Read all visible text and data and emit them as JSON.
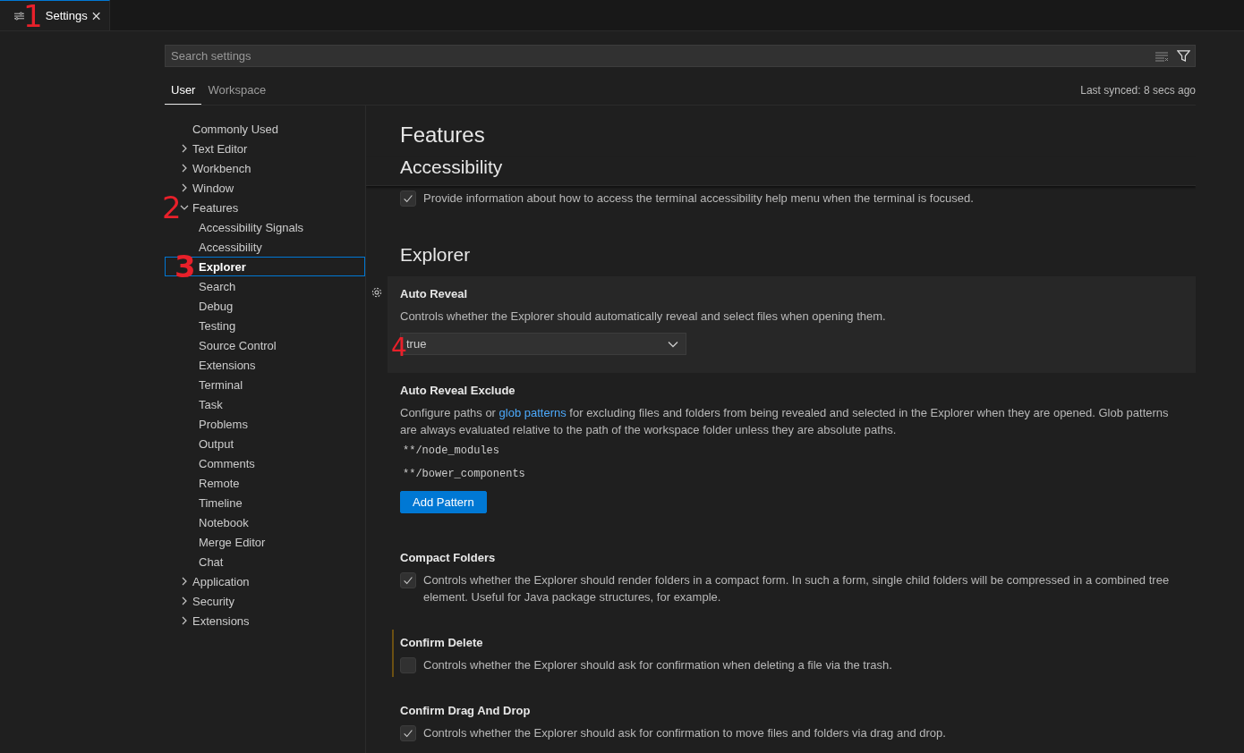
{
  "editor_tabs": [
    {
      "title": "Settings",
      "selected": true,
      "marker": "1"
    }
  ],
  "search": {
    "placeholder": "Search settings"
  },
  "scope_tabs": [
    {
      "label": "User",
      "selected": true
    },
    {
      "label": "Workspace",
      "selected": false
    }
  ],
  "sync_status": "Last synced: 8 secs ago",
  "tree": [
    {
      "label": "Commonly Used",
      "selected": false
    },
    {
      "label": "Text Editor",
      "expanded": false,
      "selected": false
    },
    {
      "label": "Workbench",
      "expanded": false,
      "selected": false
    },
    {
      "label": "Window",
      "expanded": false,
      "selected": false
    },
    {
      "label": "Features",
      "expanded": true,
      "selected": false,
      "marker": "2",
      "children": [
        {
          "label": "Accessibility Signals",
          "selected": false
        },
        {
          "label": "Accessibility",
          "selected": false
        },
        {
          "label": "Explorer",
          "selected": true,
          "marker": "3"
        },
        {
          "label": "Search",
          "selected": false
        },
        {
          "label": "Debug",
          "selected": false
        },
        {
          "label": "Testing",
          "selected": false
        },
        {
          "label": "Source Control",
          "selected": false
        },
        {
          "label": "Extensions",
          "selected": false
        },
        {
          "label": "Terminal",
          "selected": false
        },
        {
          "label": "Task",
          "selected": false
        },
        {
          "label": "Problems",
          "selected": false
        },
        {
          "label": "Output",
          "selected": false
        },
        {
          "label": "Comments",
          "selected": false
        },
        {
          "label": "Remote",
          "selected": false
        },
        {
          "label": "Timeline",
          "selected": false
        },
        {
          "label": "Notebook",
          "selected": false
        },
        {
          "label": "Merge Editor",
          "selected": false
        },
        {
          "label": "Chat",
          "selected": false
        }
      ]
    },
    {
      "label": "Application",
      "expanded": false,
      "selected": false
    },
    {
      "label": "Security",
      "expanded": false,
      "selected": false
    },
    {
      "label": "Extensions",
      "expanded": false,
      "selected": false
    }
  ],
  "content": [
    {
      "kind": "category",
      "title": "Features"
    },
    {
      "kind": "group",
      "title": "Accessibility"
    },
    {
      "kind": "checkbox",
      "checked": true,
      "description": [
        {
          "kind": "text",
          "text": "Provide information about how to access the terminal accessibility help menu when the terminal is focused."
        }
      ]
    },
    {
      "kind": "group",
      "title": "Explorer"
    },
    {
      "kind": "dropdown",
      "title": "Auto Reveal",
      "focused": true,
      "modified": false,
      "description": [
        {
          "kind": "text",
          "text": "Controls whether the Explorer should automatically reveal and select files when opening them."
        }
      ],
      "value": "true",
      "marker": "4"
    },
    {
      "kind": "list",
      "title": "Auto Reveal Exclude",
      "focused": false,
      "modified": false,
      "description": [
        {
          "kind": "text",
          "text": "Configure paths or "
        },
        {
          "kind": "link",
          "text": "glob patterns"
        },
        {
          "kind": "text",
          "text": " for excluding files and folders from being revealed and selected in the Explorer when they are opened. Glob patterns are always evaluated relative to the path of the workspace folder unless they are absolute paths."
        }
      ],
      "items": [
        "**/node_modules",
        "**/bower_components"
      ],
      "button": "Add Pattern"
    },
    {
      "kind": "checkbox",
      "title": "Compact Folders",
      "focused": false,
      "modified": false,
      "checked": true,
      "description": [
        {
          "kind": "text",
          "text": "Controls whether the Explorer should render folders in a compact form. In such a form, single child folders will be compressed in a combined tree element. Useful for Java package structures, for example."
        }
      ]
    },
    {
      "kind": "checkbox",
      "title": "Confirm Delete",
      "focused": false,
      "modified": true,
      "checked": false,
      "description": [
        {
          "kind": "text",
          "text": "Controls whether the Explorer should ask for confirmation when deleting a file via the trash."
        }
      ]
    },
    {
      "kind": "checkbox",
      "title": "Confirm Drag And Drop",
      "focused": false,
      "modified": false,
      "checked": true,
      "description": [
        {
          "kind": "text",
          "text": "Controls whether the Explorer should ask for confirmation to move files and folders via drag and drop."
        }
      ]
    }
  ]
}
